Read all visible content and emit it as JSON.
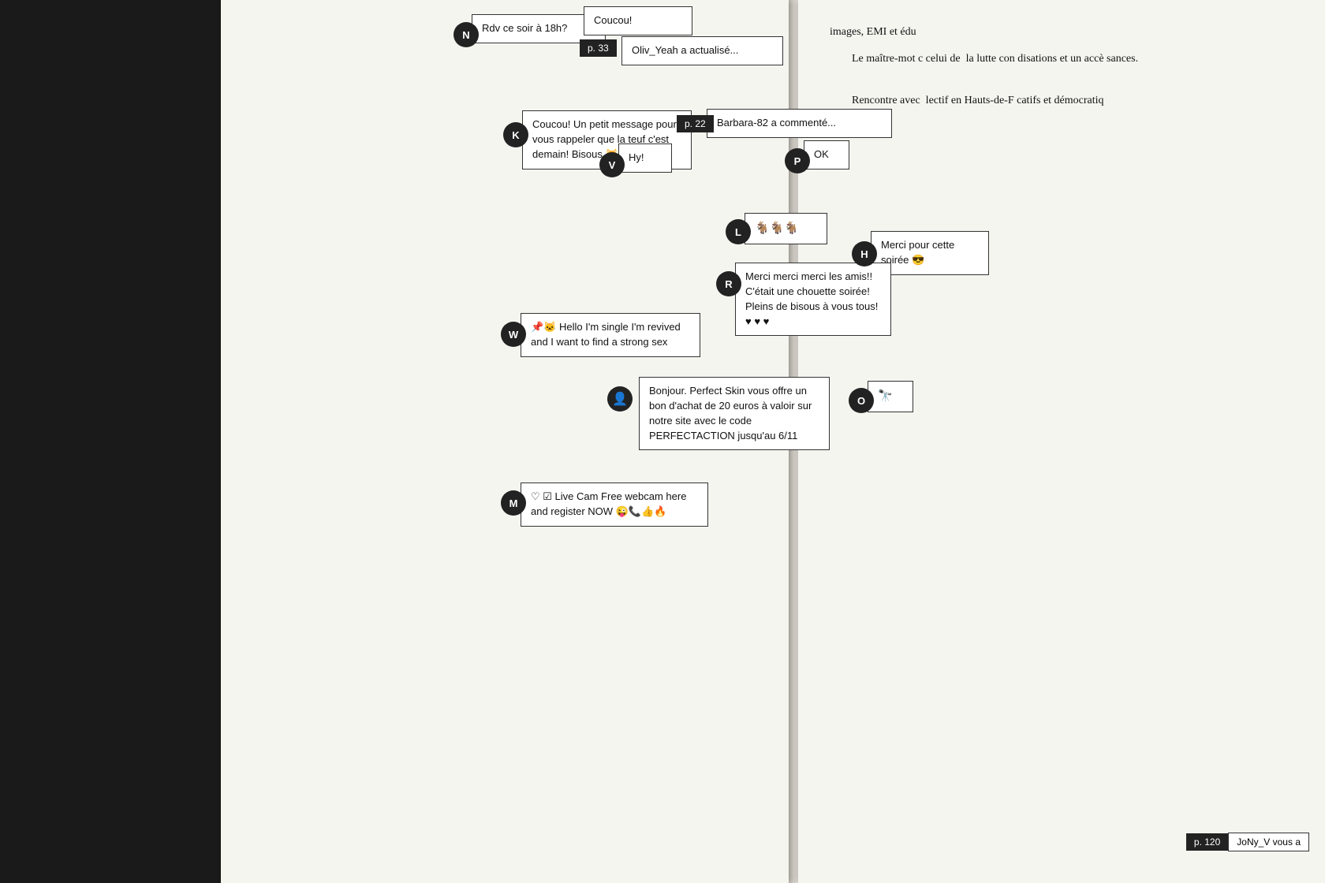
{
  "layout": {
    "leftMarginColor": "#1a1a1a",
    "leftPageBg": "#f5f5f0",
    "rightPageBg": "#f5f5f0"
  },
  "messages": [
    {
      "id": "msg-n1",
      "avatar": "N",
      "avatarLeft": 295,
      "avatarTop": 28,
      "bubbleLeft": 316,
      "bubbleTop": 18,
      "bubbleWidth": 175,
      "text": "Rdv ce soir à 18h?"
    },
    {
      "id": "msg-n2",
      "avatar": null,
      "bubbleLeft": 460,
      "bubbleTop": 10,
      "bubbleWidth": 140,
      "text": "Coucou!",
      "dark": false
    },
    {
      "id": "label-p33",
      "labelLeft": 455,
      "labelTop": 52,
      "text": "p. 33"
    },
    {
      "id": "msg-oliv",
      "bubbleLeft": 510,
      "bubbleTop": 48,
      "bubbleWidth": 210,
      "text": "Oliv_Yeah a actualisé..."
    },
    {
      "id": "msg-k",
      "avatar": "K",
      "avatarLeft": 358,
      "avatarTop": 155,
      "bubbleLeft": 385,
      "bubbleTop": 140,
      "bubbleWidth": 210,
      "text": "Coucou! Un petit message pour vous rappeler que la teuf c'est demain! Bisous 🐱🤙"
    },
    {
      "id": "msg-v",
      "avatar": "V",
      "avatarLeft": 482,
      "avatarTop": 195,
      "bubbleLeft": 505,
      "bubbleTop": 183,
      "bubbleWidth": 80,
      "text": "Hy!"
    },
    {
      "id": "label-p22",
      "labelLeft": 580,
      "labelTop": 148,
      "text": "p. 22"
    },
    {
      "id": "msg-barbara",
      "bubbleLeft": 618,
      "bubbleTop": 140,
      "bubbleWidth": 230,
      "text": "Barbara-82 a commenté..."
    },
    {
      "id": "msg-p",
      "avatar": "P",
      "avatarLeft": 715,
      "avatarTop": 188,
      "bubbleLeft": 740,
      "bubbleTop": 178,
      "bubbleWidth": 70,
      "text": "OK"
    },
    {
      "id": "msg-l",
      "avatar": "L",
      "avatarLeft": 640,
      "avatarTop": 280,
      "bubbleLeft": 665,
      "bubbleTop": 272,
      "bubbleWidth": 110,
      "text": "🐐🐐🐐"
    },
    {
      "id": "msg-h",
      "avatar": "H",
      "avatarLeft": 800,
      "avatarTop": 308,
      "bubbleLeft": 822,
      "bubbleTop": 295,
      "bubbleWidth": 155,
      "text": "Merci pour cette soirée 😎"
    },
    {
      "id": "msg-r",
      "avatar": "R",
      "avatarLeft": 628,
      "avatarTop": 345,
      "bubbleLeft": 652,
      "bubbleTop": 335,
      "bubbleWidth": 200,
      "text": "Merci merci merci les amis!! C'était une chouette soirée! Pleins de bisous à vous tous! ♥ ♥ ♥"
    },
    {
      "id": "msg-o",
      "avatar": "O",
      "avatarLeft": 795,
      "avatarTop": 495,
      "bubbleLeft": 820,
      "bubbleTop": 485,
      "bubbleWidth": 65,
      "text": "🔭"
    },
    {
      "id": "msg-w",
      "avatar": "W",
      "avatarLeft": 355,
      "avatarTop": 410,
      "bubbleLeft": 380,
      "bubbleTop": 400,
      "bubbleWidth": 230,
      "text": "📌🐱 Hello I'm single I'm revived and I want to find a strong sex"
    },
    {
      "id": "msg-perfectskin",
      "avatarIcon": "👤",
      "avatarLeft": 492,
      "avatarTop": 492,
      "bubbleLeft": 530,
      "bubbleTop": 480,
      "bubbleWidth": 245,
      "text": "Bonjour. Perfect Skin vous offre un bon d'achat de 20 euros à valoir sur notre site avec le code PERFECTACTION jusqu'au 6/11"
    },
    {
      "id": "msg-m",
      "avatar": "M",
      "avatarLeft": 355,
      "avatarTop": 625,
      "bubbleLeft": 380,
      "bubbleTop": 615,
      "bubbleWidth": 240,
      "text": "♡ ☑ Live Cam Free webcam here and register NOW 😜📞👍🔥"
    }
  ],
  "rightPage": {
    "paragraphs": [
      "images, EMI et édu",
      "Le maître-mot c celui de  la lutte con disations et un accè sances.",
      "",
      "Rencontre avec  lectif en Hauts-de-F catifs et démocratiq"
    ],
    "bottomLabel": {
      "pageNum": "p. 120",
      "text": "JoNy_V vous a"
    }
  }
}
